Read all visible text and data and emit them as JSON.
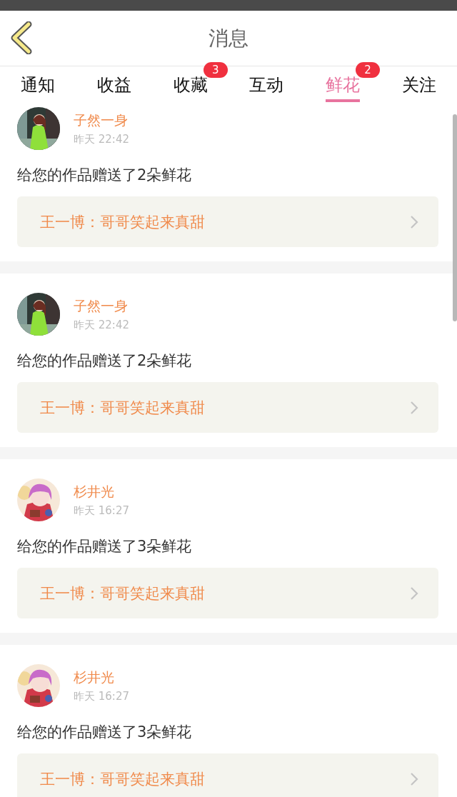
{
  "header": {
    "title": "消息"
  },
  "tabs": [
    {
      "label": "通知",
      "selected": false
    },
    {
      "label": "收益",
      "selected": false
    },
    {
      "label": "收藏",
      "selected": false,
      "badge": "3"
    },
    {
      "label": "互动",
      "selected": false
    },
    {
      "label": "鲜花",
      "selected": true,
      "badge": "2"
    },
    {
      "label": "关注",
      "selected": false
    }
  ],
  "messages": [
    {
      "name": "子然一身",
      "time": "昨天 22:42",
      "text": "给您的作品赠送了2朵鲜花",
      "quote": "王一博：哥哥笑起来真甜"
    },
    {
      "name": "子然一身",
      "time": "昨天 22:42",
      "text": "给您的作品赠送了2朵鲜花",
      "quote": "王一博：哥哥笑起来真甜"
    },
    {
      "name": "杉井光",
      "time": "昨天 16:27",
      "text": "给您的作品赠送了3朵鲜花",
      "quote": "王一博：哥哥笑起来真甜"
    },
    {
      "name": "杉井光",
      "time": "昨天 16:27",
      "text": "给您的作品赠送了3朵鲜花",
      "quote": "王一博：哥哥笑起来真甜"
    }
  ]
}
